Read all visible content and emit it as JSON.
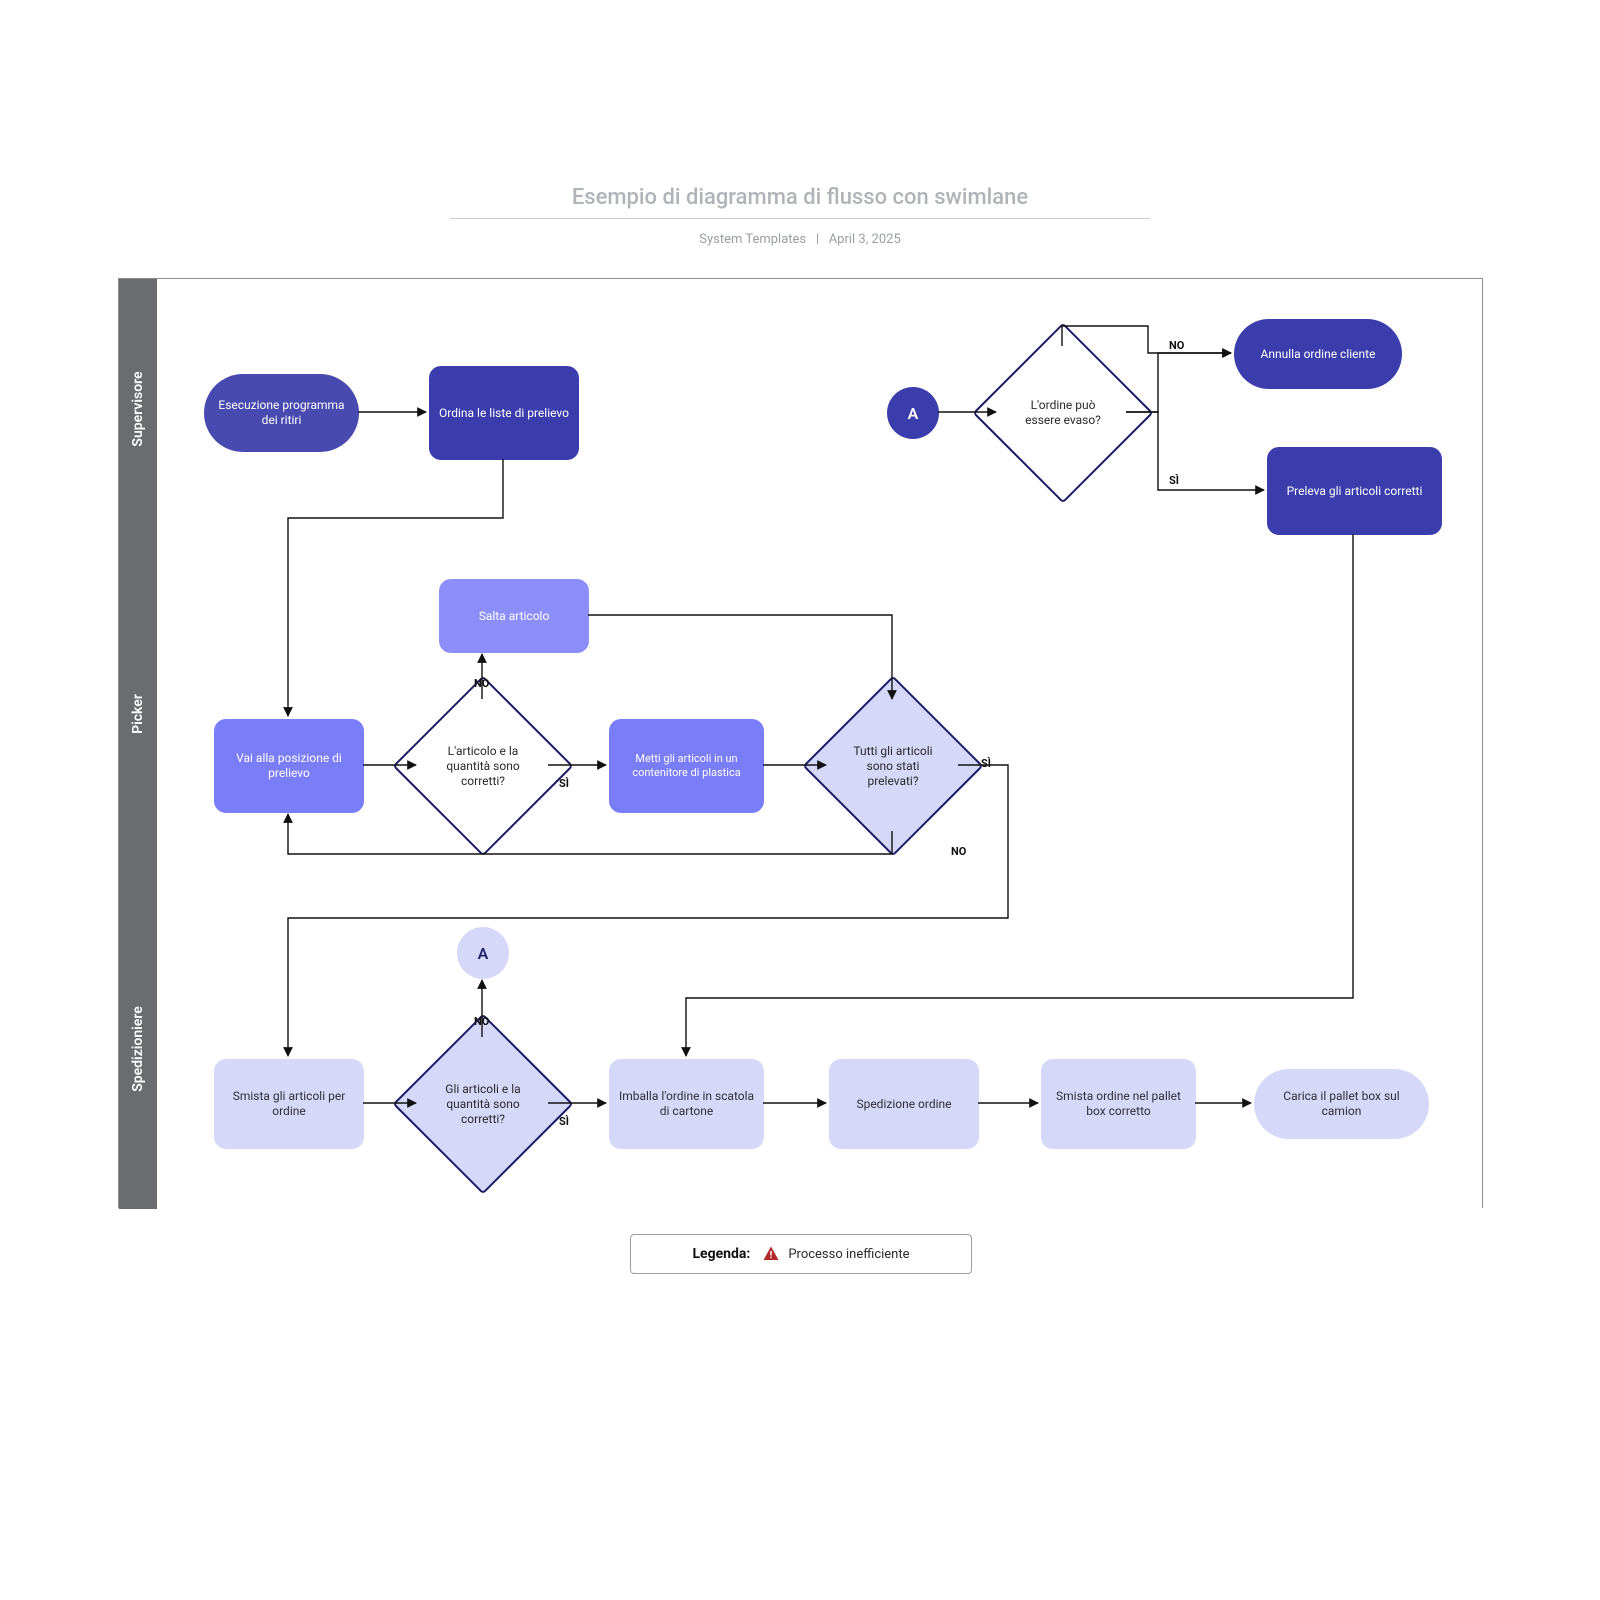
{
  "title": "Esempio di diagramma di flusso con swimlane",
  "subtitle_author": "System Templates",
  "subtitle_date": "April 3, 2025",
  "lanes": {
    "supervisore": "Supervisore",
    "picker": "Picker",
    "spedizioniere": "Spedizioniere"
  },
  "nodes": {
    "start": "Esecuzione programma dei ritiri",
    "sort_lists": "Ordina le liste di prelievo",
    "a_ref": "A",
    "can_fill": "L'ordine può essere evaso?",
    "cancel": "Annulla ordine cliente",
    "pick_correct": "Preleva gli articoli corretti",
    "goto": "Vai alla posizione di prelievo",
    "skip": "Salta articolo",
    "item_ok": "L'articolo e la quantità sono corretti?",
    "tote": "Metti gli articoli in un contenitore di plastica",
    "all_picked": "Tutti gli articoli sono stati prelevati?",
    "sort_order": "Smista gli articoli per ordine",
    "a_back": "A",
    "items_ok2": "Gli articoli e la quantità sono corretti?",
    "pack": "Imballa l'ordine in scatola di cartone",
    "ship": "Spedizione ordine",
    "sort_pallet": "Smista ordine nel pallet box corretto",
    "load": "Carica il pallet box sul camion"
  },
  "labels": {
    "yes": "SÌ",
    "no": "NO"
  },
  "legend": {
    "title": "Legenda:",
    "item": "Processo inefficiente"
  }
}
